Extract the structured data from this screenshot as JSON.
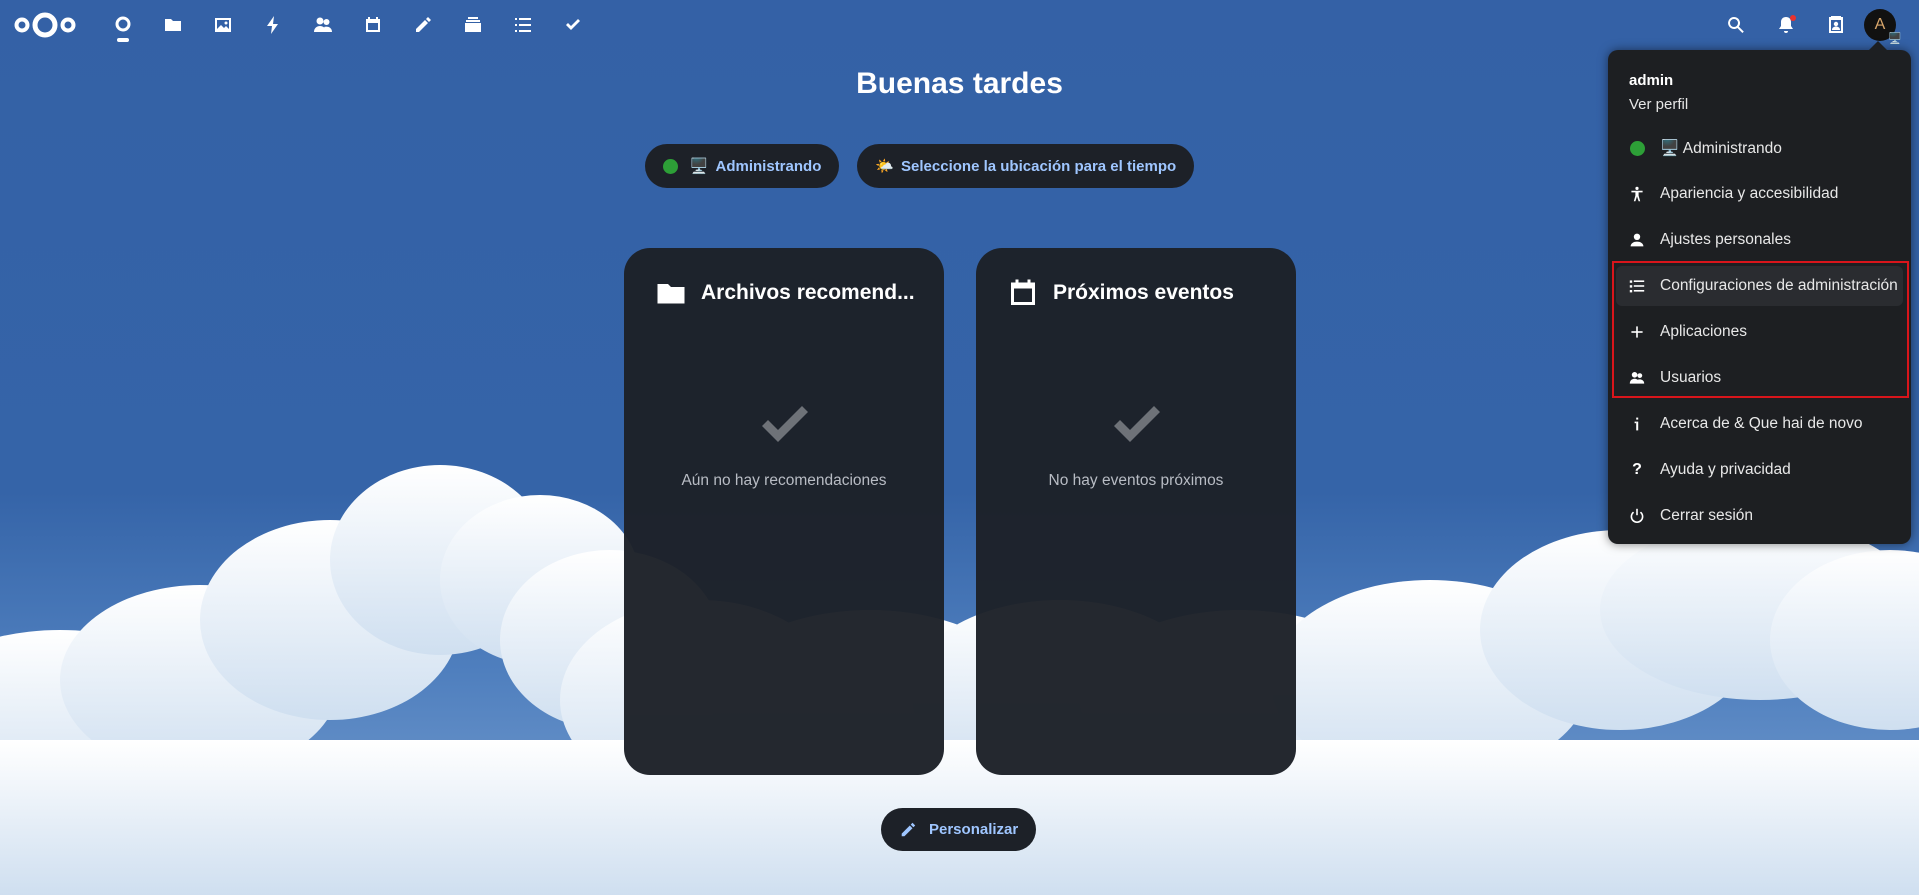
{
  "header": {
    "apps": [
      {
        "name": "dashboard-icon",
        "active": true
      },
      {
        "name": "files-icon"
      },
      {
        "name": "photos-icon"
      },
      {
        "name": "activity-icon"
      },
      {
        "name": "contacts-icon"
      },
      {
        "name": "calendar-icon"
      },
      {
        "name": "notes-icon"
      },
      {
        "name": "deck-icon"
      },
      {
        "name": "tasks-list-icon"
      },
      {
        "name": "check-icon"
      }
    ],
    "avatar_letter": "A"
  },
  "greeting": "Buenas tardes",
  "status_pill": {
    "emoji": "🖥️",
    "label": "Administrando"
  },
  "weather_pill": {
    "emoji": "🌤️",
    "label": "Seleccione la ubicación para el tiempo"
  },
  "widgets": {
    "files": {
      "title": "Archivos recomend...",
      "empty": "Aún no hay recomendaciones"
    },
    "events": {
      "title": "Próximos eventos",
      "empty": "No hay eventos próximos"
    }
  },
  "customize_label": "Personalizar",
  "menu": {
    "user": "admin",
    "profile": "Ver perfil",
    "status": "🖥️ Administrando",
    "items": {
      "appearance": "Apariencia y accesibilidad",
      "personal": "Ajustes personales",
      "admin": "Configuraciones de administración",
      "apps": "Aplicaciones",
      "users": "Usuarios",
      "about": "Acerca de & Que hai de novo",
      "help": "Ayuda y privacidad",
      "logout": "Cerrar sesión"
    }
  },
  "colors": {
    "accent": "#9fc6ff",
    "background": "#3461a6",
    "status_online": "#2d9f37",
    "highlight": "#d9151b"
  }
}
